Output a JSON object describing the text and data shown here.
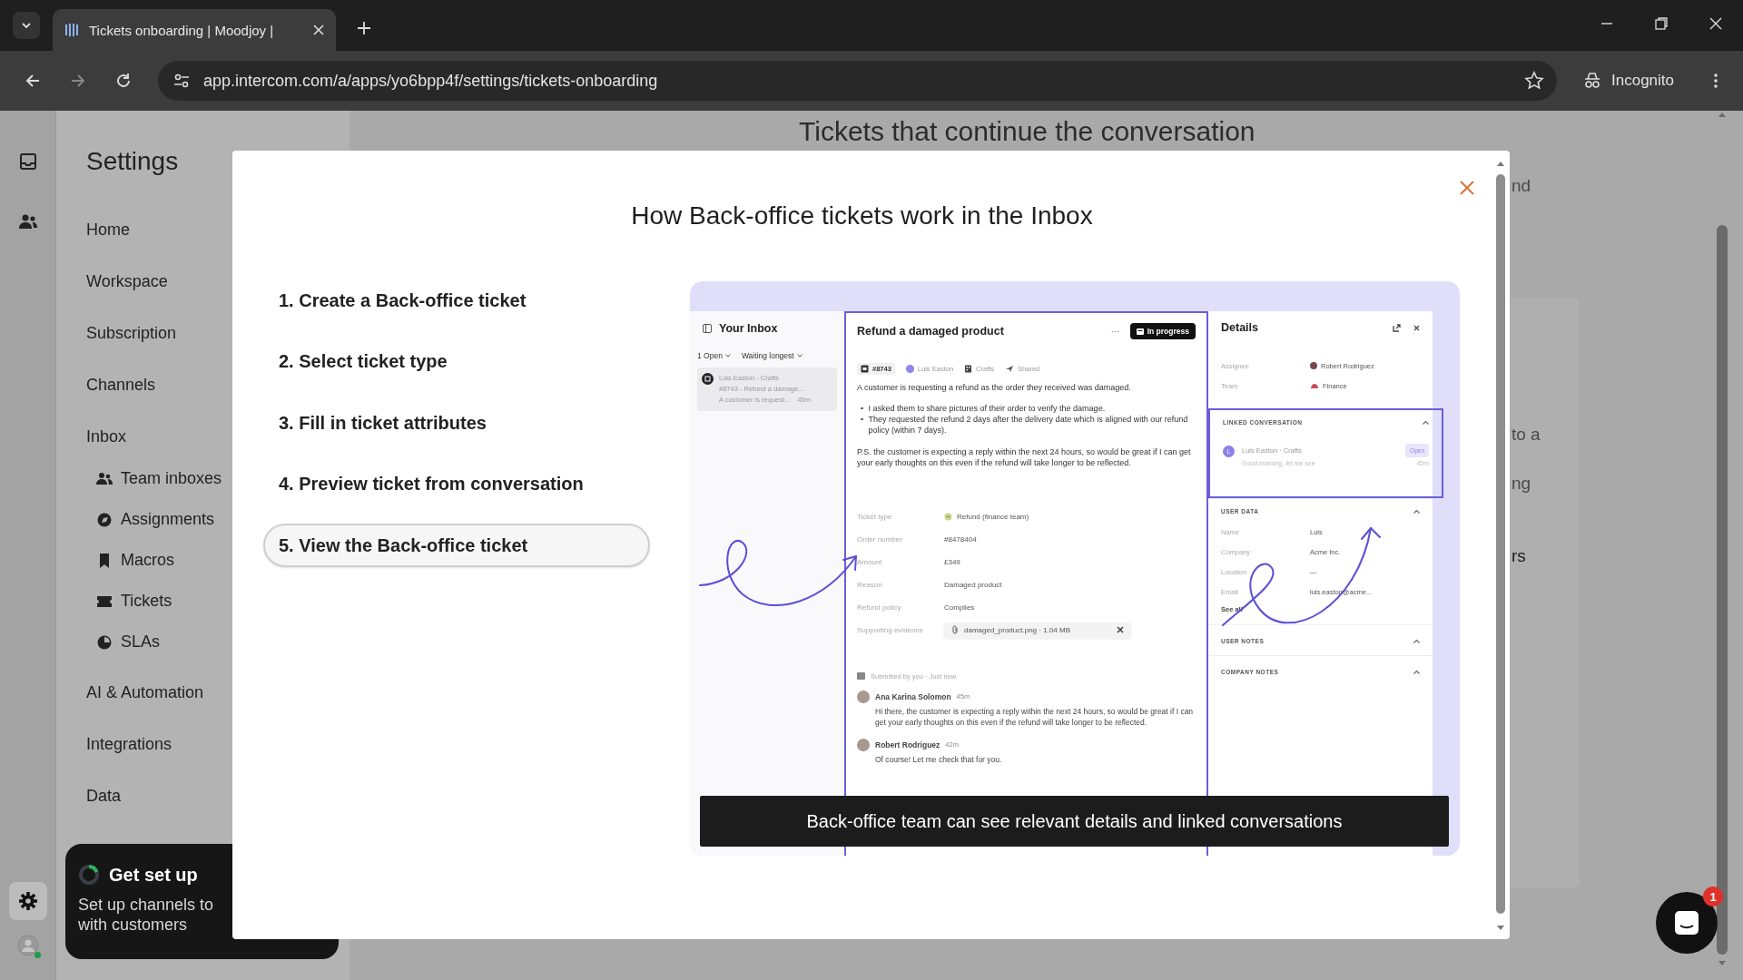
{
  "browser": {
    "tab_title": "Tickets onboarding | Moodjoy |",
    "url": "app.intercom.com/a/apps/yo6bpp4f/settings/tickets-onboarding",
    "profile_label": "Incognito"
  },
  "settings": {
    "title": "Settings",
    "items": [
      {
        "label": "Home",
        "kind": "section"
      },
      {
        "label": "Workspace",
        "kind": "section"
      },
      {
        "label": "Subscription",
        "kind": "section"
      },
      {
        "label": "Channels",
        "kind": "section"
      },
      {
        "label": "Inbox",
        "kind": "section"
      },
      {
        "label": "Team inboxes",
        "kind": "subitem"
      },
      {
        "label": "Assignments",
        "kind": "subitem"
      },
      {
        "label": "Macros",
        "kind": "subitem"
      },
      {
        "label": "Tickets",
        "kind": "subitem"
      },
      {
        "label": "SLAs",
        "kind": "subitem"
      },
      {
        "label": "AI & Automation",
        "kind": "section"
      },
      {
        "label": "Integrations",
        "kind": "section"
      },
      {
        "label": "Data",
        "kind": "section"
      }
    ]
  },
  "setup_card": {
    "title": "Get set up",
    "lines": [
      "Set up channels to",
      "with customers"
    ]
  },
  "page": {
    "heading": "Tickets that continue the conversation",
    "fragments": [
      "nd",
      "to a",
      "ng",
      "rs"
    ]
  },
  "modal": {
    "title": "How Back-office tickets work in the Inbox",
    "steps": [
      {
        "label": "1. Create a Back-office ticket",
        "selected": false
      },
      {
        "label": "2. Select ticket type",
        "selected": false
      },
      {
        "label": "3. Fill in ticket attributes",
        "selected": false
      },
      {
        "label": "4. Preview ticket from conversation",
        "selected": false
      },
      {
        "label": "5. View the Back-office ticket",
        "selected": true
      }
    ],
    "caption": "Back-office team can see relevant details and linked conversations",
    "preview": {
      "inbox": {
        "title": "Your Inbox",
        "filters": [
          "1 Open",
          "Waiting longest"
        ],
        "item": {
          "name": "Luis Easton - Crafts",
          "subject": "#8743 - Refund a damage...",
          "snippet": "A customer is request...",
          "time": "45m"
        }
      },
      "ticket": {
        "title": "Refund a damaged product",
        "more": "···",
        "status": "In progress",
        "meta": [
          "#8743",
          "Luis Easton",
          "Crafts",
          "Shared"
        ],
        "intro": "A customer is requesting a refund as the order they received was damaged.",
        "bullets": [
          "I asked them to share pictures of their order to verify the damage.",
          "They requested the refund 2 days after the delivery date which is aligned with our refund policy (within 7 days)."
        ],
        "note": "P.S. the customer is expecting a reply within the next 24 hours, so would be great if I can get your early thoughts on this even if the refund will take longer to be reflected.",
        "attributes": [
          {
            "label": "Ticket type",
            "value": "Refund (finance team)",
            "kind": "type"
          },
          {
            "label": "Order number",
            "value": "#8478404",
            "kind": "text"
          },
          {
            "label": "Amount",
            "value": "£349",
            "kind": "text"
          },
          {
            "label": "Reason",
            "value": "Damaged product",
            "kind": "text"
          },
          {
            "label": "Refund policy",
            "value": "Complies",
            "kind": "text"
          },
          {
            "label": "Supporting evidence",
            "value": "damaged_product.png · 1.04 MB",
            "kind": "file"
          }
        ],
        "submitted": "Submitted by you · Just now",
        "messages": [
          {
            "author": "Ana Karina Solomon",
            "time": "45m",
            "text": "Hi there, the customer is expecting a reply within the next 24 hours, so would be great if I can get your early thoughts on this even if the refund will take longer to be reflected."
          },
          {
            "author": "Robert Rodriguez",
            "time": "42m",
            "text": "Of course! Let me check that for you."
          }
        ]
      },
      "details": {
        "title": "Details",
        "fields": [
          {
            "label": "Assignee",
            "value": "Robert Rodriguez"
          },
          {
            "label": "Team",
            "value": "Finance"
          }
        ],
        "sections": [
          {
            "title": "LINKED CONVERSATION",
            "kind": "linked",
            "highlighted": true,
            "conversation": {
              "initial": "L",
              "name": "Luis Easton · Crafts",
              "status": "Open",
              "snippet": "Good morning, let me see",
              "time": "45m"
            }
          },
          {
            "title": "USER DATA",
            "kind": "data",
            "highlighted": false,
            "fields": [
              {
                "label": "Name",
                "value": "Luis"
              },
              {
                "label": "Company",
                "value": "Acme Inc."
              },
              {
                "label": "Location",
                "value": "—"
              },
              {
                "label": "Email",
                "value": "luis.easton@acme..."
              }
            ],
            "link": "See all"
          },
          {
            "title": "USER NOTES",
            "kind": "header",
            "highlighted": false
          },
          {
            "title": "COMPANY NOTES",
            "kind": "header",
            "highlighted": false
          }
        ]
      }
    }
  },
  "messenger": {
    "badge": "1"
  }
}
